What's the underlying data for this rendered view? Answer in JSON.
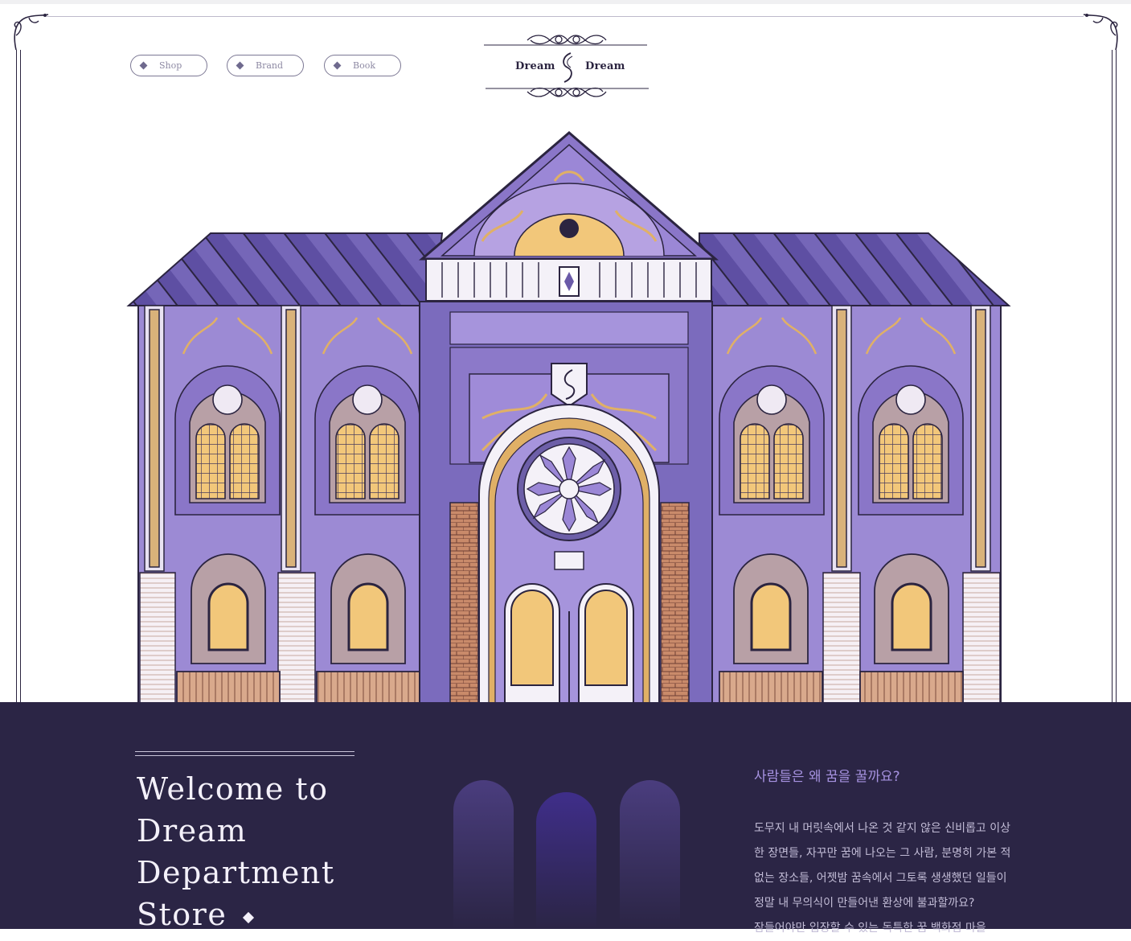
{
  "nav": {
    "items": [
      {
        "label": "Shop"
      },
      {
        "label": "Brand"
      },
      {
        "label": "Book"
      }
    ]
  },
  "logo": {
    "left_word": "Dream",
    "right_word": "Dream"
  },
  "hero": {
    "illustration": "dream-department-store-building"
  },
  "welcome": {
    "lines": [
      "Welcome to",
      "Dream",
      "Department",
      "Store"
    ]
  },
  "intro": {
    "question": "사람들은 왜 꿈을 꿀까요?",
    "lines": [
      "도무지 내 머릿속에서 나온 것 같지 않은 신비롭고 이상",
      "한 장면들, 자꾸만 꿈에 나오는 그 사람, 분명히 가본 적",
      "없는 장소들, 어젯밤 꿈속에서 그토록 생생했던 일들이",
      "정말 내 무의식이 만들어낸 환상에 불과할까요?",
      "잠들어야만 입장할 수 있는 독특한 꿈 백화점 마을"
    ]
  },
  "colors": {
    "dark_navy": "#2b2545",
    "lavender": "#a692e0",
    "roof_purple": "#6a5aa8",
    "wall_purple": "#9c8ad4",
    "window_gold": "#f2c77a",
    "brick": "#c98a6a"
  }
}
